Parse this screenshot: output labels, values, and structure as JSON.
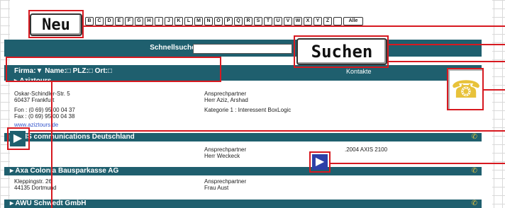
{
  "buttons": {
    "neu": "Neu",
    "suchen": "Suchen"
  },
  "alphabet": [
    "B",
    "C",
    "D",
    "E",
    "F",
    "G",
    "H",
    "I",
    "J",
    "K",
    "L",
    "M",
    "N",
    "O",
    "P",
    "Q",
    "R",
    "S",
    "T",
    "U",
    "V",
    "W",
    "X",
    "Y",
    "Z",
    "",
    "Alle"
  ],
  "search": {
    "label": "Schnellsuche:",
    "value": ""
  },
  "filter": {
    "text": "Firma:▼   Name:□   PLZ:□ Ort:□",
    "kontakte": "Kontakte"
  },
  "companies": [
    {
      "name": "▸ Aziztours",
      "address": [
        "Oskar-Schindler-Str. 5",
        "60437 Frankfurt"
      ],
      "phones": [
        "Fon : (0 69) 95 00 04 37",
        "Fax : (0 69) 95 00 04 38"
      ],
      "web": "www.aziztours.de",
      "contact": [
        "Ansprechpartner",
        "Herr Aziz, Arshad"
      ],
      "category": "Kategorie 1 : Interessent BoxLogic"
    },
    {
      "name": "▸ AXIS communications Deutschland",
      "address": [],
      "contact": [
        "Ansprechpartner",
        "Herr Weckeck"
      ],
      "extra": ".2004 AXIS 2100"
    },
    {
      "name": "▸ Axa Colonia Bausparkasse AG",
      "address": [
        "Kleppingstr. 26",
        "44135 Dortmund"
      ],
      "contact": [
        "Ansprechpartner",
        "Frau Aust"
      ]
    },
    {
      "name": "▸ AWU Schwedt GmbH"
    }
  ],
  "icons": {
    "phone": "phone-icon",
    "arrow": "arrow-right-icon"
  },
  "colors": {
    "teal": "#1f5f6e",
    "annotation_red": "#d71920",
    "phone_yellow": "#e8c23a"
  }
}
